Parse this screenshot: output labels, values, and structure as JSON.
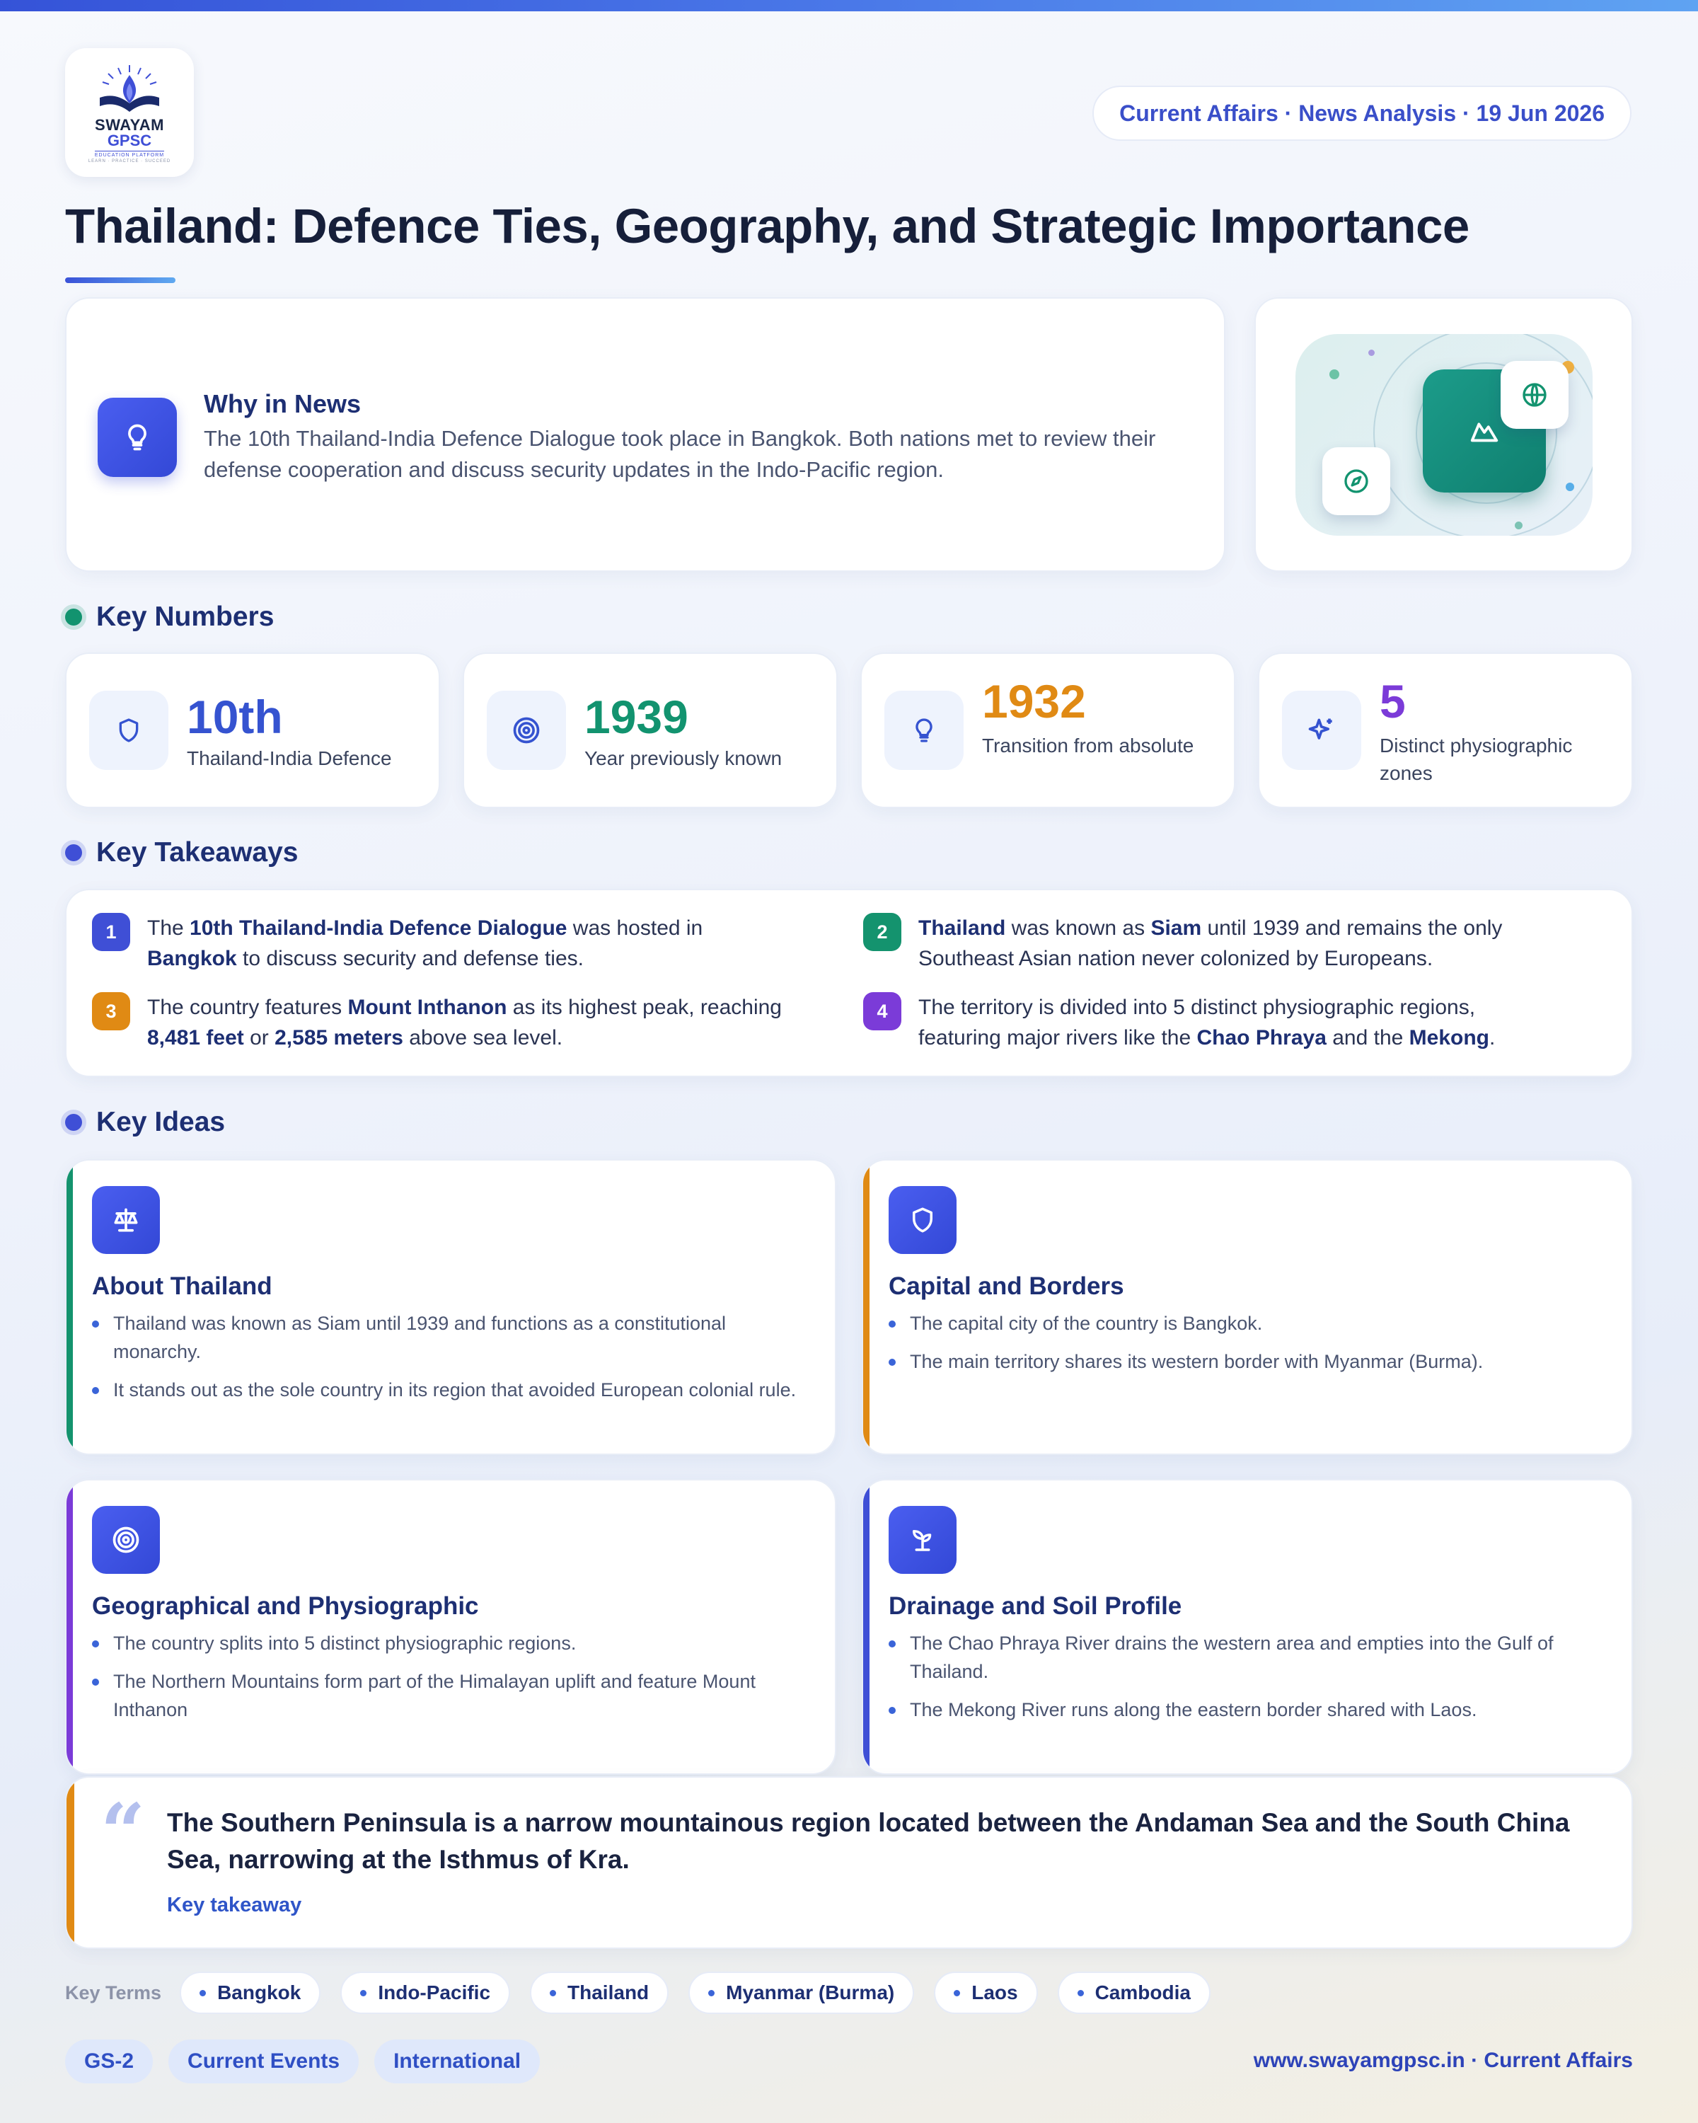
{
  "header": {
    "logo_line1": "SWAYAM",
    "logo_line2": "GPSC",
    "logo_line3": "EDUCATION PLATFORM",
    "logo_line4": "LEARN · PRACTICE · SUCCEED",
    "date_pill": "Current Affairs · News Analysis · 19 Jun 2026",
    "title": "Thailand: Defence Ties, Geography, and Strategic Importance"
  },
  "why_in_news": {
    "title": "Why in News",
    "text": "The 10th Thailand-India Defence Dialogue took place in Bangkok. Both nations met to review their defense cooperation and discuss security updates in the Indo-Pacific region.",
    "icon": "lightbulb-icon"
  },
  "sections": {
    "key_numbers": "Key Numbers",
    "key_takeaways": "Key Takeaways",
    "key_ideas": "Key Ideas"
  },
  "stats": [
    {
      "value": "10th",
      "label": "Thailand-India Defence",
      "color": "#3553d0",
      "icon": "shield-icon"
    },
    {
      "value": "1939",
      "label": "Year previously known",
      "color": "#12936f",
      "icon": "target-icon"
    },
    {
      "value": "1932",
      "label": "Transition from absolute",
      "color": "#e08a14",
      "icon": "lightbulb-icon"
    },
    {
      "value": "5",
      "label": "Distinct physiographic zones",
      "color": "#7b3bd8",
      "icon": "sparkle-icon"
    }
  ],
  "takeaways": [
    {
      "num": "1",
      "color": "#3f4fd6",
      "parts": [
        {
          "t": "The "
        },
        {
          "t": "10th Thailand-India Defence Dialogue",
          "b": true
        },
        {
          "t": " was hosted in "
        },
        {
          "t": "Bangkok",
          "b": true
        },
        {
          "t": " to discuss security and defense ties."
        }
      ]
    },
    {
      "num": "2",
      "color": "#14936e",
      "parts": [
        {
          "t": "Thailand",
          "b": true
        },
        {
          "t": " was known as "
        },
        {
          "t": "Siam",
          "b": true
        },
        {
          "t": " until 1939 and remains the only Southeast Asian nation never colonized by Europeans."
        }
      ]
    },
    {
      "num": "3",
      "color": "#e08a14",
      "parts": [
        {
          "t": "The country features "
        },
        {
          "t": "Mount Inthanon",
          "b": true
        },
        {
          "t": " as its highest peak, reaching "
        },
        {
          "t": "8,481 feet",
          "b": true
        },
        {
          "t": " or "
        },
        {
          "t": "2,585 meters",
          "b": true
        },
        {
          "t": " above sea level."
        }
      ]
    },
    {
      "num": "4",
      "color": "#7b3bd8",
      "parts": [
        {
          "t": "The territory is divided into 5 distinct physiographic regions, featuring major rivers like the "
        },
        {
          "t": "Chao Phraya",
          "b": true
        },
        {
          "t": " and the "
        },
        {
          "t": "Mekong",
          "b": true
        },
        {
          "t": "."
        }
      ]
    }
  ],
  "ideas": [
    {
      "title": "About Thailand",
      "accent": "#14936e",
      "icon": "scales-icon",
      "points": [
        "Thailand was known as Siam until 1939 and functions as a constitutional monarchy.",
        "It stands out as the sole country in its region that avoided European colonial rule."
      ]
    },
    {
      "title": "Capital and Borders",
      "accent": "#e08a14",
      "icon": "shield-icon",
      "points": [
        "The capital city of the country is Bangkok.",
        "The main territory shares its western border with Myanmar (Burma)."
      ]
    },
    {
      "title": "Geographical and Physiographic",
      "accent": "#7b3bd8",
      "icon": "target-icon",
      "points": [
        "The country splits into 5 distinct physiographic regions.",
        "The Northern Mountains form part of the Himalayan uplift and feature Mount Inthanon"
      ]
    },
    {
      "title": "Drainage and Soil Profile",
      "accent": "#3f4fd6",
      "icon": "sprout-icon",
      "points": [
        "The Chao Phraya River drains the western area and empties into the Gulf of Thailand.",
        "The Mekong River runs along the eastern border shared with Laos."
      ]
    }
  ],
  "quote": {
    "text": "The Southern Peninsula is a narrow mountainous region located between the Andaman Sea and the South China Sea, narrowing at the Isthmus of Kra.",
    "source": "Key takeaway"
  },
  "key_terms": {
    "label": "Key Terms",
    "items": [
      "Bangkok",
      "Indo-Pacific",
      "Thailand",
      "Myanmar (Burma)",
      "Laos",
      "Cambodia"
    ]
  },
  "tags": [
    "GS-2",
    "Current Events",
    "International"
  ],
  "footer": "www.swayamgpsc.in · Current Affairs"
}
